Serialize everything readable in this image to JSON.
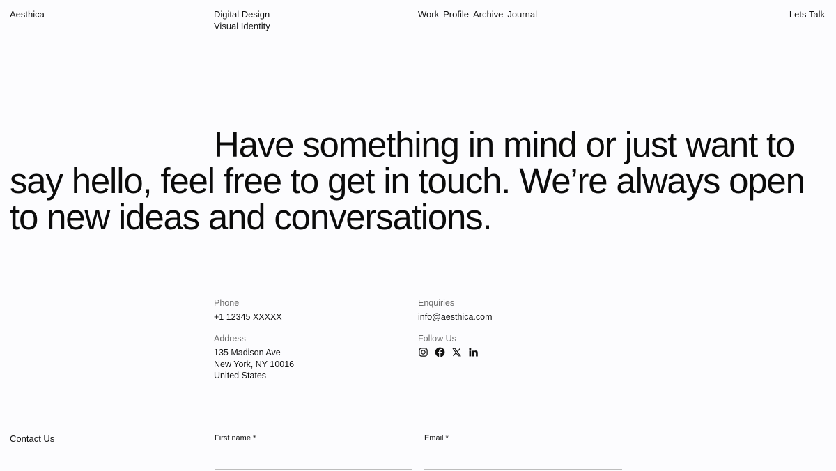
{
  "header": {
    "brand": "Aesthica",
    "tagline": [
      "Digital Design",
      "Visual Identity"
    ],
    "nav": [
      "Work",
      "Profile",
      "Archive",
      "Journal"
    ],
    "cta": "Lets Talk"
  },
  "hero": {
    "text": "Have something in mind or just want to say hello, feel free to get in touch. We’re always open to new ideas and conversations."
  },
  "contact_info": {
    "phone_label": "Phone",
    "phone": "+1 12345 XXXXX",
    "address_label": "Address",
    "address": [
      "135 Madison Ave",
      "New York, NY 10016",
      "United States"
    ],
    "enquiries_label": "Enquiries",
    "email": "info@aesthica.com",
    "follow_label": "Follow Us",
    "social_icons": [
      "instagram-icon",
      "facebook-icon",
      "x-icon",
      "linkedin-icon"
    ]
  },
  "form": {
    "title": "Contact Us",
    "first_name_label": "First name *",
    "email_label": "Email *",
    "first_name_value": "",
    "email_value": ""
  }
}
